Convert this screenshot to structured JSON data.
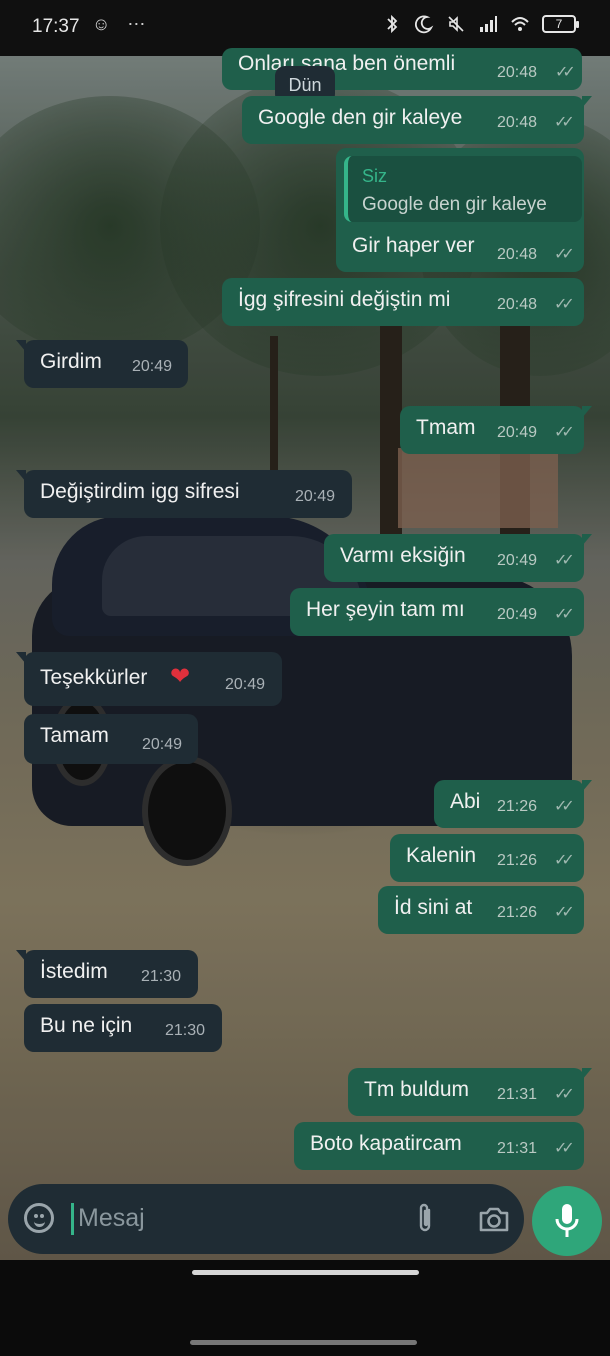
{
  "status_bar": {
    "time": "17:37",
    "left_icons": "☺ ⋯",
    "battery": "7"
  },
  "chat": {
    "date_chip": "Dün",
    "partial_top": {
      "text": "Onları sana ben önemli",
      "time": "20:48"
    },
    "messages": [
      {
        "dir": "out",
        "text": "Google den gir kaleye",
        "time": "20:48"
      },
      {
        "dir": "out",
        "quote_name": "Siz",
        "quote_text": "Google den gir kaleye",
        "text": "Gir haper ver",
        "time": "20:48"
      },
      {
        "dir": "out",
        "text": "İgg şifresini değiştin mi",
        "time": "20:48"
      },
      {
        "dir": "in",
        "text": "Girdim",
        "time": "20:49"
      },
      {
        "dir": "out",
        "text": "Tmam",
        "time": "20:49"
      },
      {
        "dir": "in",
        "text": "Değiştirdim igg sifresi",
        "time": "20:49"
      },
      {
        "dir": "out",
        "text": "Varmı eksiğin",
        "time": "20:49"
      },
      {
        "dir": "out",
        "text": "Her şeyin tam mı",
        "time": "20:49"
      },
      {
        "dir": "in",
        "text": "Teşekkürler",
        "emoji": "❤",
        "time": "20:49"
      },
      {
        "dir": "in",
        "text": "Tamam",
        "time": "20:49"
      },
      {
        "dir": "out",
        "text": "Abi",
        "time": "21:26"
      },
      {
        "dir": "out",
        "text": "Kalenin",
        "time": "21:26"
      },
      {
        "dir": "out",
        "text": "İd sini at",
        "time": "21:26"
      },
      {
        "dir": "in",
        "text": "İstedim",
        "time": "21:30"
      },
      {
        "dir": "in",
        "text": "Bu ne için",
        "time": "21:30"
      },
      {
        "dir": "out",
        "text": "Tm buldum",
        "time": "21:31"
      },
      {
        "dir": "out",
        "text": "Boto kapatircam",
        "time": "21:31"
      }
    ]
  },
  "composer": {
    "placeholder": "Mesaj"
  },
  "colors": {
    "outgoing_bubble": "#1f5f4b",
    "incoming_bubble": "#1f2c34",
    "accent": "#2fa67a"
  },
  "icons": [
    "emoji-icon",
    "attach-icon",
    "camera-icon",
    "mic-icon",
    "read-ticks-icon",
    "bluetooth-icon",
    "moon-icon",
    "mute-icon",
    "signal-icon",
    "wifi-icon",
    "battery-icon"
  ]
}
